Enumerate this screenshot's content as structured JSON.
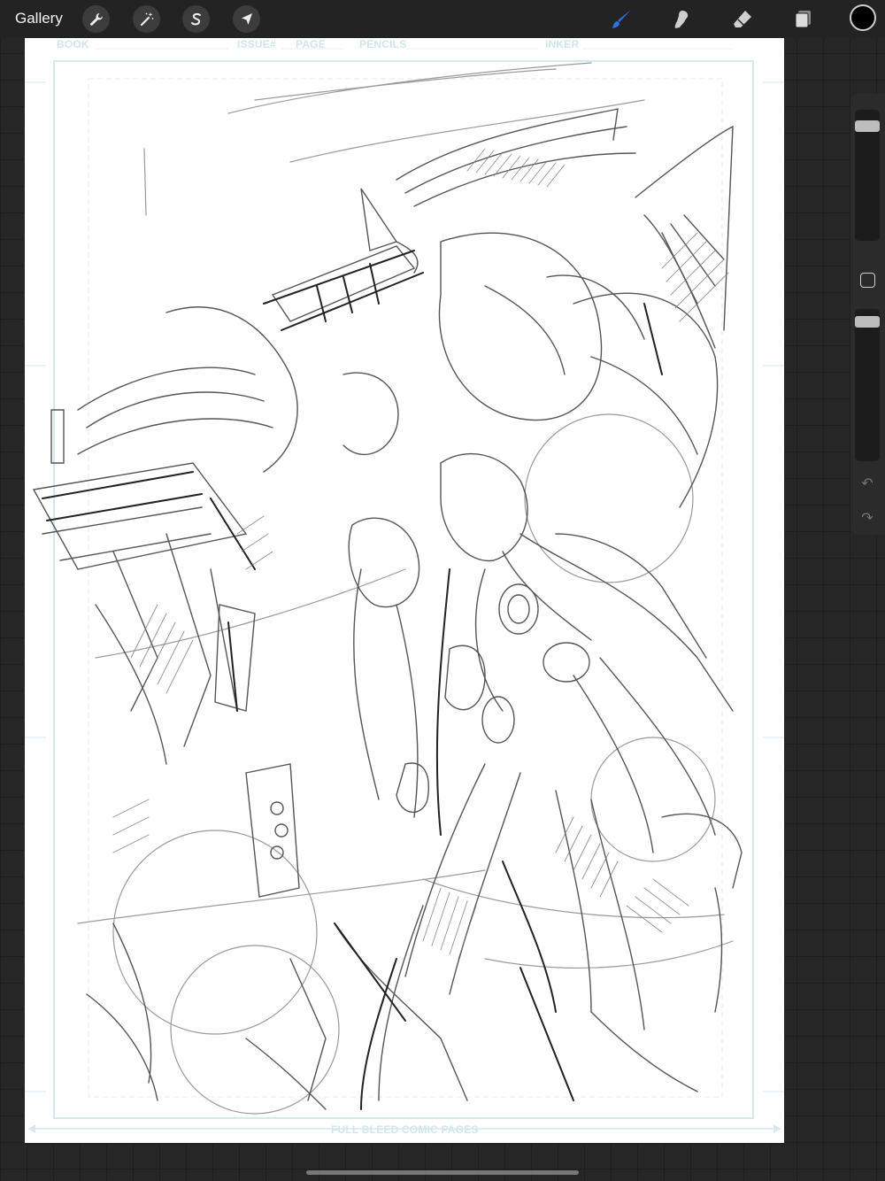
{
  "topbar": {
    "gallery_label": "Gallery",
    "tools_left": [
      "wrench-icon",
      "magic-wand-icon",
      "selection-s-icon",
      "transform-arrow-icon"
    ],
    "tools_right": [
      "brush-icon",
      "smudge-icon",
      "eraser-icon",
      "layers-icon"
    ],
    "active_tool": "brush-icon",
    "accent_color": "#2f6fe0",
    "current_color": "#000000"
  },
  "template": {
    "header_fields": [
      "BOOK",
      "ISSUE#",
      "PAGE",
      "PENCILS",
      "INKER"
    ],
    "footer_label": "FULL BLEED COMIC PAGES"
  },
  "sidebar": {
    "brush_size_level": 0.08,
    "opacity_level": 0.04
  }
}
